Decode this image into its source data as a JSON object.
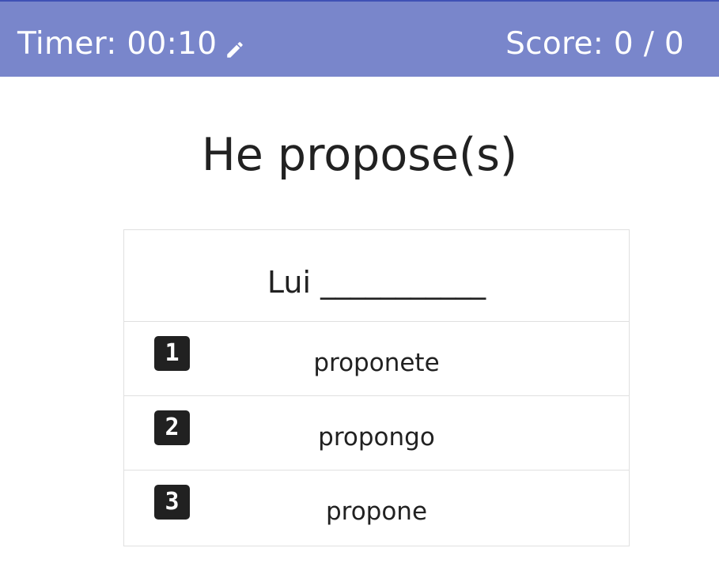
{
  "header": {
    "timer_label": "Timer: 00:10",
    "score_label": "Score: 0 / 0",
    "edit_icon": "pencil-icon",
    "background_color": "#7986cb"
  },
  "question": {
    "text": "He propose(s)"
  },
  "prompt": {
    "text": "Lui ___________"
  },
  "options": [
    {
      "key": "1",
      "label": "proponete"
    },
    {
      "key": "2",
      "label": "propongo"
    },
    {
      "key": "3",
      "label": "propone"
    }
  ]
}
